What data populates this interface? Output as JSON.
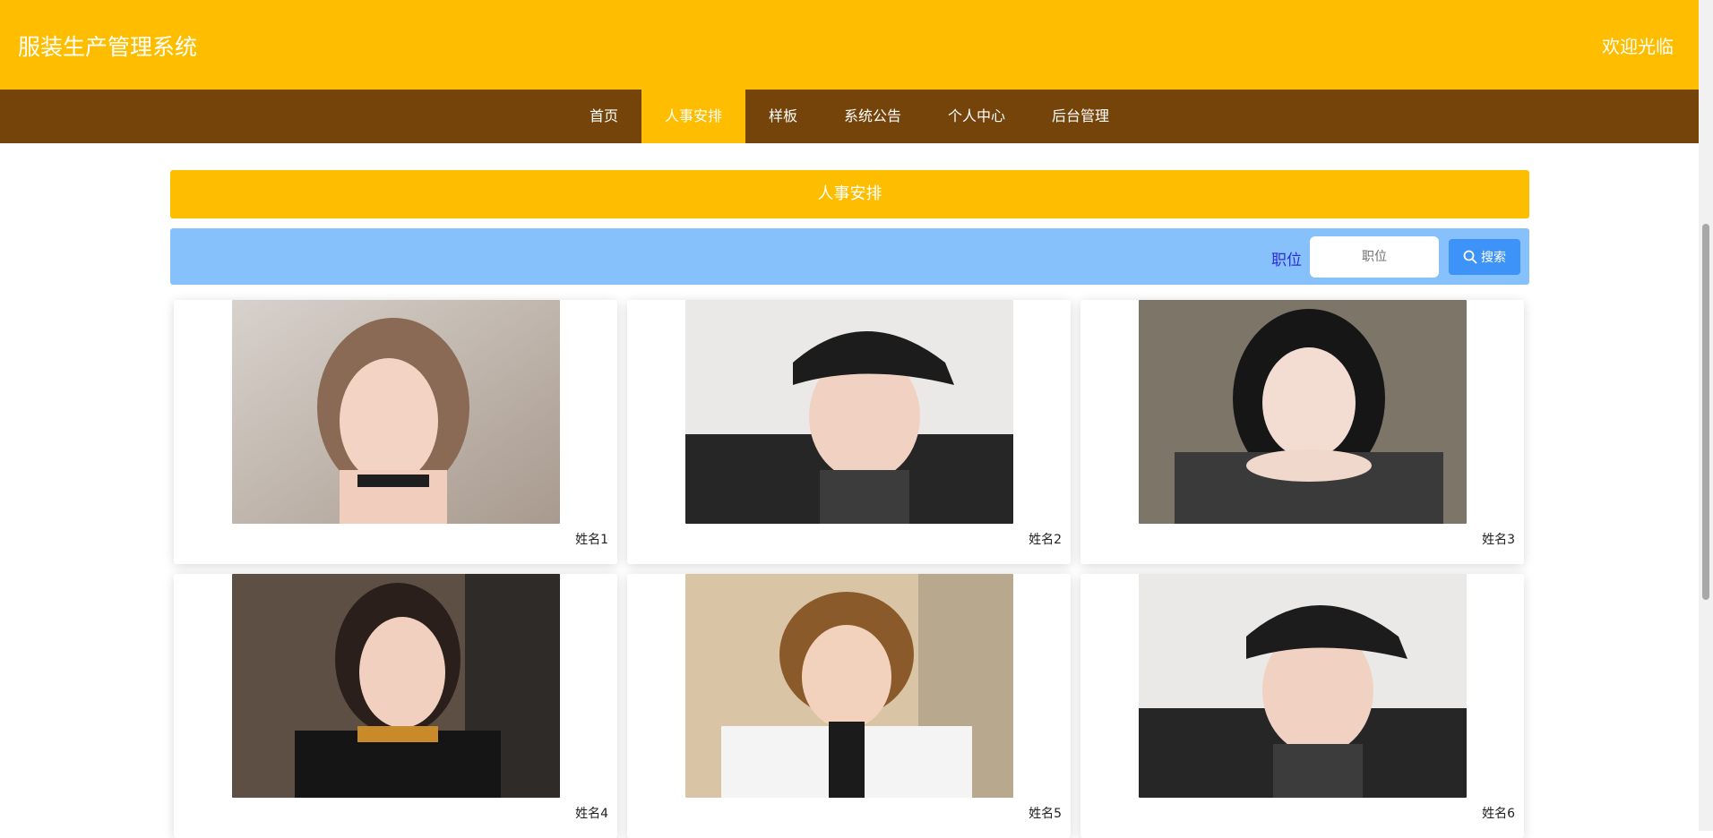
{
  "header": {
    "title": "服装生产管理系统",
    "welcome": "欢迎光临"
  },
  "nav": {
    "items": [
      {
        "label": "首页",
        "active": false
      },
      {
        "label": "人事安排",
        "active": true
      },
      {
        "label": "样板",
        "active": false
      },
      {
        "label": "系统公告",
        "active": false
      },
      {
        "label": "个人中心",
        "active": false
      },
      {
        "label": "后台管理",
        "active": false
      }
    ]
  },
  "page": {
    "section_title": "人事安排",
    "search": {
      "label": "职位",
      "placeholder": "职位",
      "button_label": "搜索",
      "icon": "search-icon"
    }
  },
  "cards": [
    {
      "name": "姓名1",
      "photo": "portrait-photo"
    },
    {
      "name": "姓名2",
      "photo": "portrait-photo"
    },
    {
      "name": "姓名3",
      "photo": "portrait-photo"
    },
    {
      "name": "姓名4",
      "photo": "portrait-photo"
    },
    {
      "name": "姓名5",
      "photo": "portrait-photo"
    },
    {
      "name": "姓名6",
      "photo": "portrait-photo"
    }
  ],
  "colors": {
    "header_bg": "#ffbd00",
    "nav_bg": "#75440a",
    "nav_active_bg": "#ffbd00",
    "search_bar_bg": "#87c1fb",
    "search_button_bg": "#3d93f8"
  }
}
